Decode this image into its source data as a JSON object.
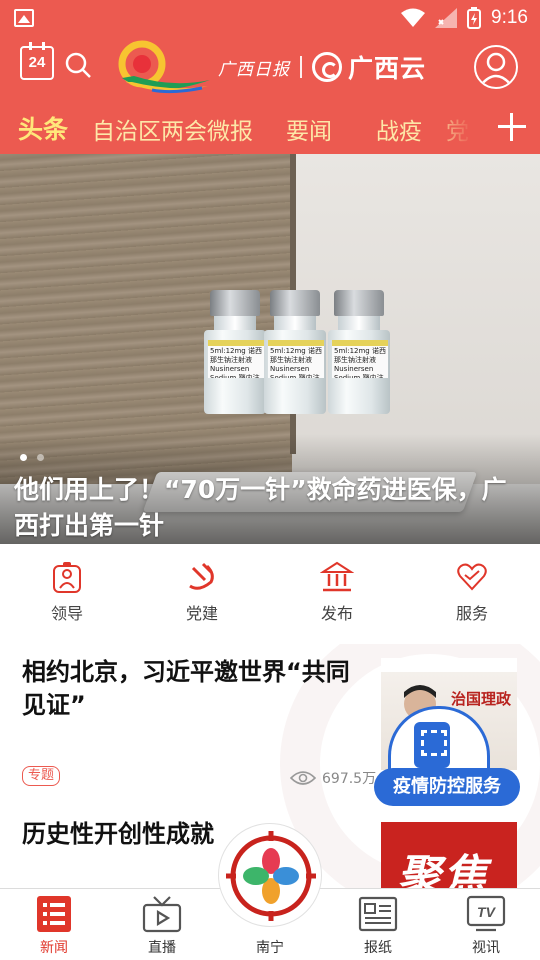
{
  "status_bar": {
    "time": "9:16"
  },
  "header": {
    "calendar_day": "24",
    "paper_name": "广西日报",
    "app_name": "广西云"
  },
  "tabs": {
    "items": [
      "头条",
      "自治区两会微报",
      "要闻",
      "战疫",
      "党"
    ]
  },
  "banner": {
    "caption": "他们用上了！“70万一针”救命药进医保，广西打出第一针",
    "vial_label": "5ml:12mg 诺西那生钠注射液 Nusinersen Sodium 鞘内注射",
    "slide_count": 2,
    "active_slide": 1
  },
  "quick_menu": [
    {
      "label": "领导",
      "icon": "person-badge-icon"
    },
    {
      "label": "党建",
      "icon": "party-emblem-icon"
    },
    {
      "label": "发布",
      "icon": "government-building-icon"
    },
    {
      "label": "服务",
      "icon": "heart-icon"
    }
  ],
  "feed": [
    {
      "title": "相约北京，习近平邀世界“共同见证”",
      "tag": "专题",
      "views": "697.5万",
      "thumb_text": "治国理政"
    },
    {
      "title": "历史性开创性成就",
      "thumb_text": "聚焦"
    }
  ],
  "fab": {
    "label": "疫情防控服务"
  },
  "bottom_nav": {
    "items": [
      {
        "label": "新闻",
        "icon": "news-list-icon",
        "active": true
      },
      {
        "label": "直播",
        "icon": "tv-play-icon",
        "active": false
      },
      {
        "label": "南宁",
        "icon": "nanning-flower-icon",
        "active": false
      },
      {
        "label": "报纸",
        "icon": "newspaper-icon",
        "active": false
      },
      {
        "label": "视讯",
        "icon": "tv-icon",
        "active": false
      }
    ]
  },
  "colors": {
    "brand_red": "#ec5a50",
    "tab_text": "#fde7a8",
    "active_tab": "#ffe77a",
    "fab_blue": "#2b6ad6",
    "nav_active": "#e0362a"
  }
}
